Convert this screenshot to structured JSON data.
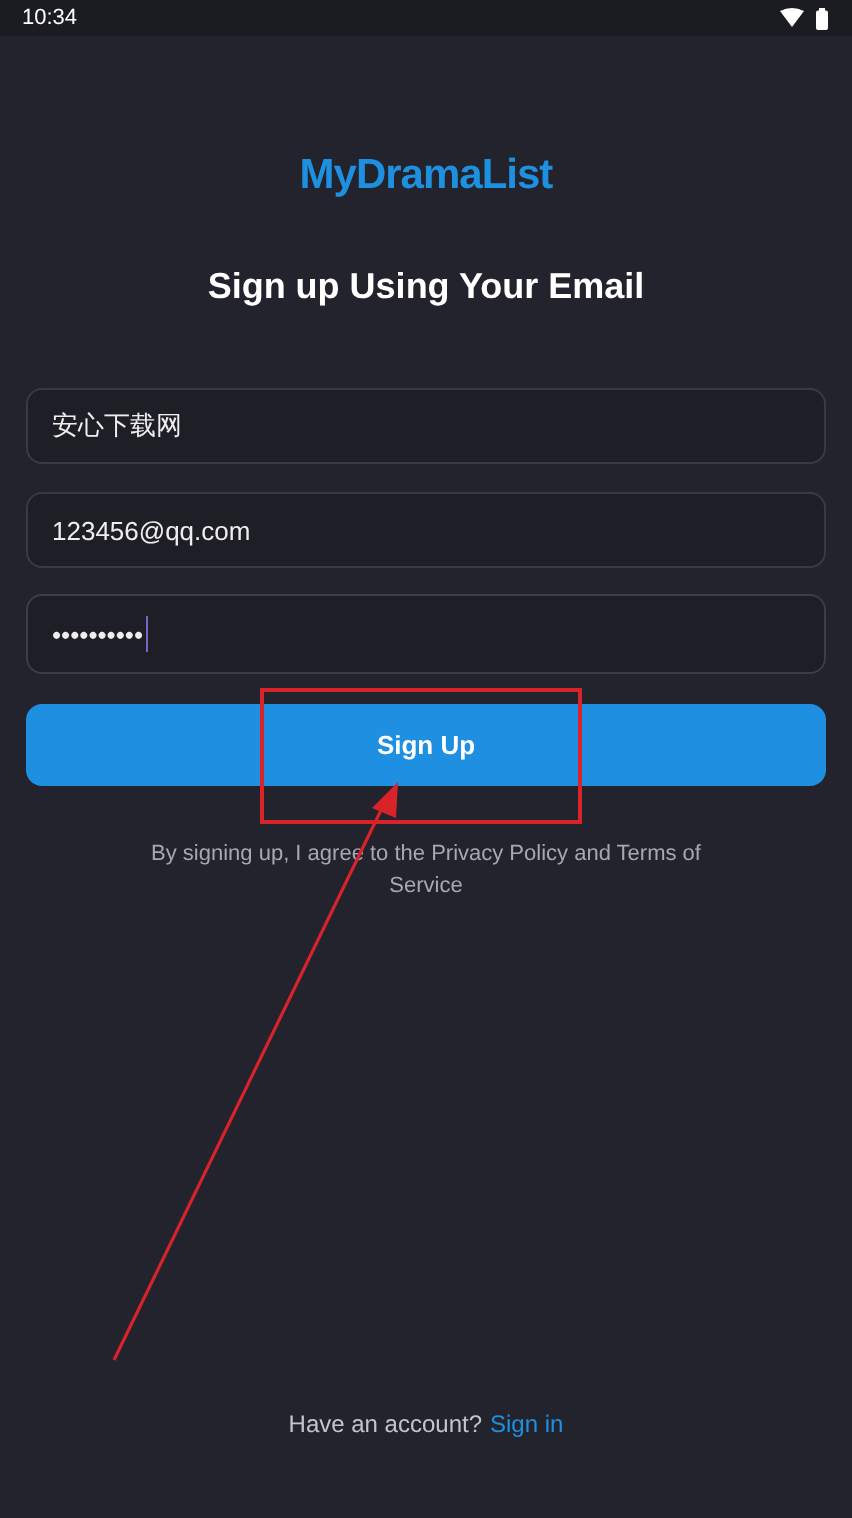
{
  "status_bar": {
    "time": "10:34"
  },
  "logo": {
    "text": "MyDramaList"
  },
  "title": "Sign up Using Your Email",
  "fields": [
    {
      "value": "安心下载网",
      "focused": false
    },
    {
      "value": "123456@qq.com",
      "focused": false
    },
    {
      "value": "••••••••••",
      "focused": true
    }
  ],
  "submit_button": {
    "label": "Sign Up"
  },
  "terms": "By signing up, I agree to the Privacy Policy and Terms of Service",
  "footer": {
    "prompt": "Have an account?",
    "link": "Sign in"
  },
  "annotations": {
    "highlight_box": true,
    "arrow": true
  }
}
